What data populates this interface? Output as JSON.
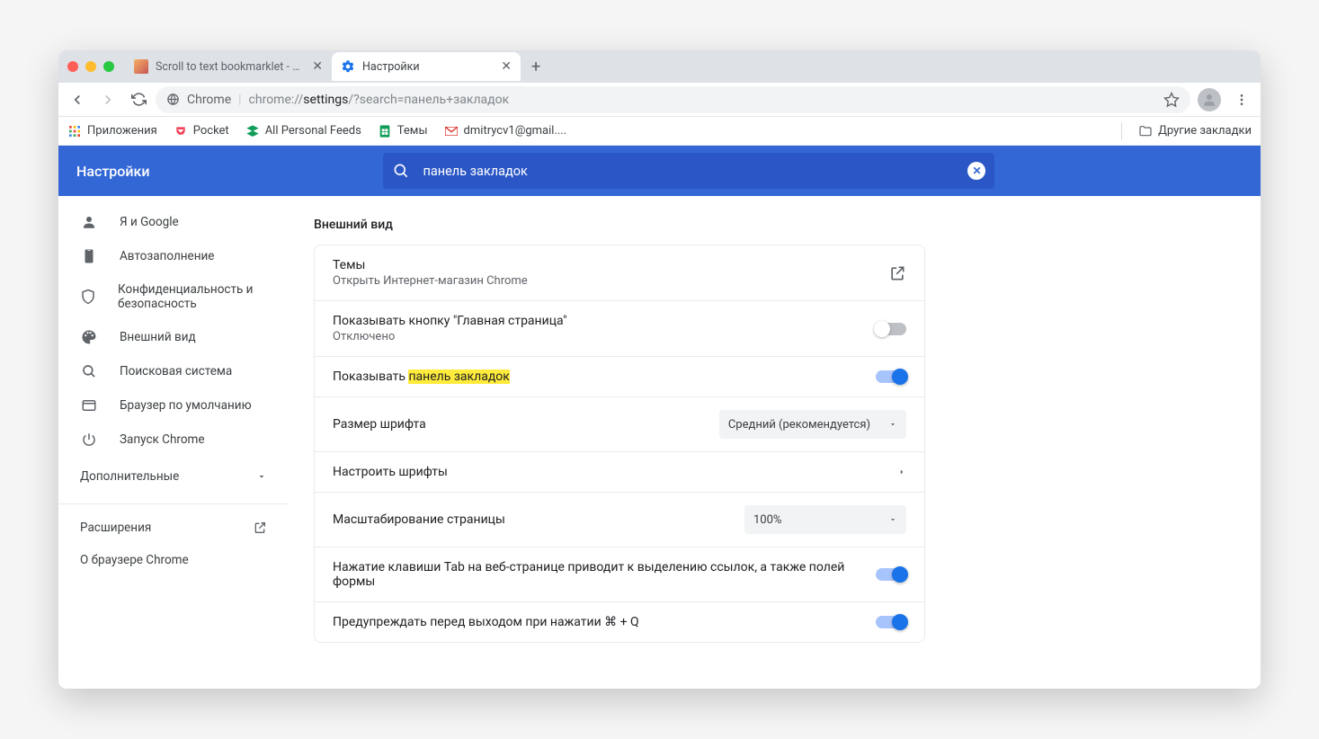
{
  "tabs": [
    {
      "title": "Scroll to text bookmarklet - Me"
    },
    {
      "title": "Настройки"
    }
  ],
  "omnibox": {
    "host": "Chrome",
    "path_prefix": "chrome://",
    "path_bold": "settings",
    "path_rest": "/?search=панель+закладок"
  },
  "bookmarks": {
    "apps": "Приложения",
    "pocket": "Pocket",
    "feeds": "All Personal Feeds",
    "themes": "Темы",
    "gmail": "dmitrycv1@gmail....",
    "other": "Другие закладки"
  },
  "header": {
    "title": "Настройки",
    "search_value": "панель закладок"
  },
  "sidebar": {
    "items": [
      {
        "label": "Я и Google"
      },
      {
        "label": "Автозаполнение"
      },
      {
        "label": "Конфиденциальность и безопасность"
      },
      {
        "label": "Внешний вид"
      },
      {
        "label": "Поисковая система"
      },
      {
        "label": "Браузер по умолчанию"
      },
      {
        "label": "Запуск Chrome"
      }
    ],
    "additional": "Дополнительные",
    "extensions": "Расширения",
    "about": "О браузере Chrome"
  },
  "main": {
    "section_title": "Внешний вид",
    "rows": {
      "themes": {
        "title": "Темы",
        "subtitle": "Открыть Интернет-магазин Chrome"
      },
      "home_button": {
        "title": "Показывать кнопку \"Главная страница\"",
        "subtitle": "Отключено"
      },
      "show_bookmarks_prefix": "Показывать ",
      "show_bookmarks_highlight": "панель закладок",
      "font_size": {
        "title": "Размер шрифта",
        "value": "Средний (рекомендуется)"
      },
      "customize_fonts": "Настроить шрифты",
      "page_zoom": {
        "title": "Масштабирование страницы",
        "value": "100%"
      },
      "tab_highlights": "Нажатие клавиши Tab на веб-странице приводит к выделению ссылок, а также полей формы",
      "warn_quit": "Предупреждать перед выходом при нажатии ⌘ + Q"
    }
  }
}
